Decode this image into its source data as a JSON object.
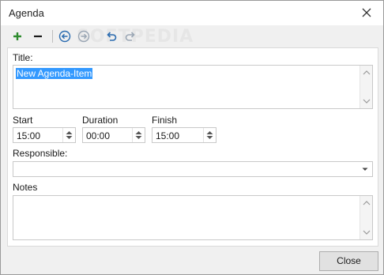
{
  "window": {
    "title": "Agenda"
  },
  "toolbar": {
    "buttons": [
      {
        "name": "add-icon"
      },
      {
        "name": "remove-icon"
      },
      {
        "name": "previous-icon"
      },
      {
        "name": "next-icon"
      },
      {
        "name": "undo-icon"
      },
      {
        "name": "redo-icon"
      }
    ],
    "watermark": "SOFTPEDIA"
  },
  "form": {
    "title_label": "Title:",
    "title_value": "New Agenda-Item",
    "start_label": "Start",
    "start_value": "15:00",
    "duration_label": "Duration",
    "duration_value": "00:00",
    "finish_label": "Finish",
    "finish_value": "15:00",
    "responsible_label": "Responsible:",
    "responsible_value": "",
    "notes_label": "Notes",
    "notes_value": ""
  },
  "footer": {
    "close_label": "Close"
  },
  "colors": {
    "selection": "#3399ff",
    "add_green": "#2e8b2e",
    "nav_blue": "#2b6cb0"
  }
}
